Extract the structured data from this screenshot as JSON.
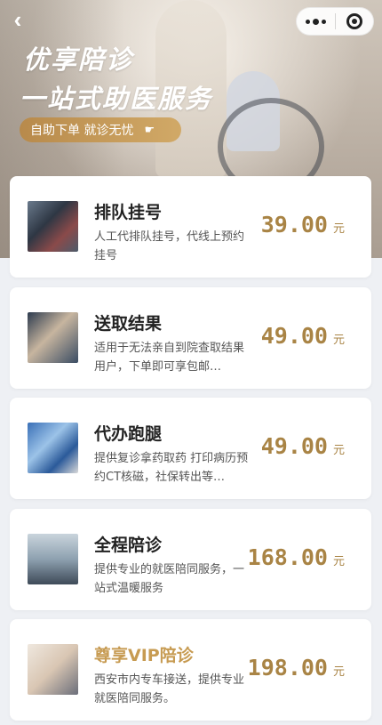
{
  "header": {
    "title_line1": "优享陪诊",
    "title_line2": "一站式助医服务",
    "cta_label": "自助下单 就诊无忧",
    "cta_icon": "hand-pointer-icon",
    "back_icon": "chevron-left-icon",
    "more_icon": "more-dots-icon",
    "close_icon": "target-close-icon"
  },
  "services": [
    {
      "name": "排队挂号",
      "desc": "人工代排队挂号，代线上预约挂号",
      "price": "39.00",
      "unit": "元"
    },
    {
      "name": "送取结果",
      "desc": "适用于无法亲自到院查取结果用户，下单即可享包邮…",
      "price": "49.00",
      "unit": "元"
    },
    {
      "name": "代办跑腿",
      "desc": "提供复诊拿药取药 打印病历预约CT核磁，社保转出等…",
      "price": "49.00",
      "unit": "元"
    },
    {
      "name": "全程陪诊",
      "desc": "提供专业的就医陪同服务，一站式温暖服务",
      "price": "168.00",
      "unit": "元"
    },
    {
      "name": "尊享VIP陪诊",
      "desc": "西安市内专车接送，提供专业就医陪同服务。",
      "price": "198.00",
      "unit": "元"
    }
  ],
  "colors": {
    "accent_gold": "#a98445",
    "vip_gold": "#c79b52",
    "pill_start": "#b88a4b",
    "pill_end": "#d1a967"
  }
}
